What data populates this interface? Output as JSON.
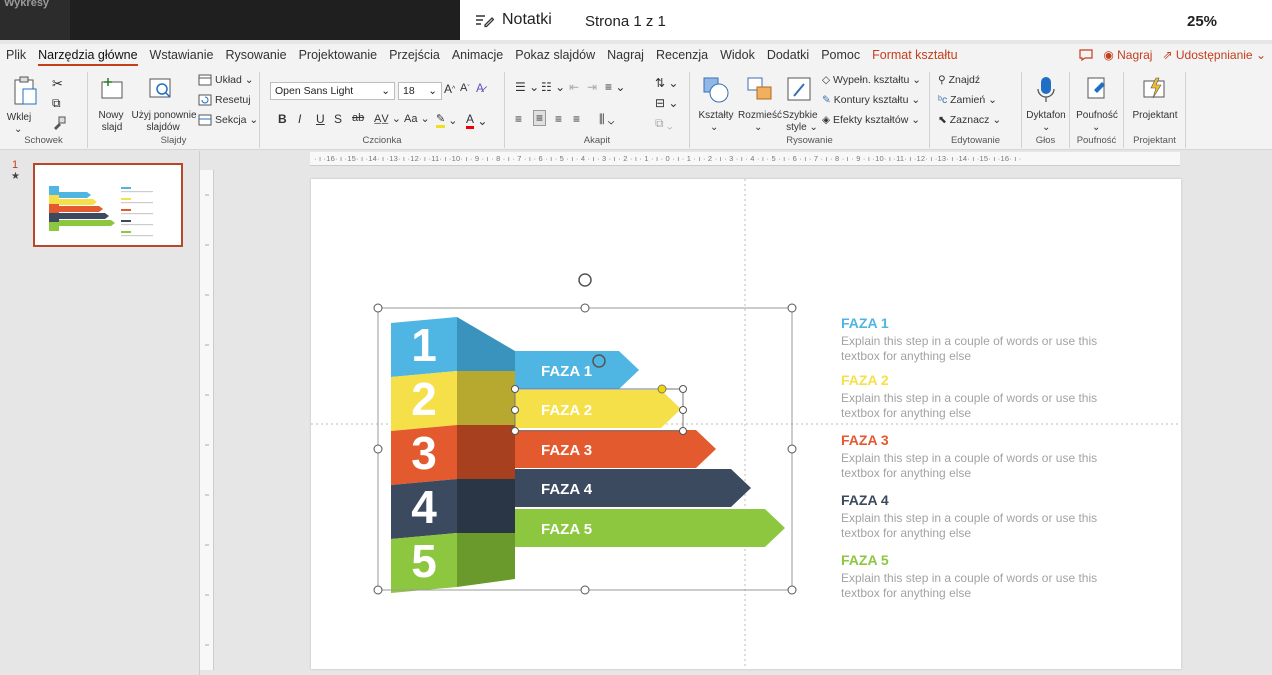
{
  "topbar": {
    "left_tab_label": "Wykresy",
    "notes_label": "Notatki",
    "page_label": "Strona 1 z 1",
    "zoom_label": "25%"
  },
  "menu": {
    "items": [
      "Plik",
      "Narzędzia główne",
      "Wstawianie",
      "Rysowanie",
      "Projektowanie",
      "Przejścia",
      "Animacje",
      "Pokaz slajdów",
      "Nagraj",
      "Recenzja",
      "Widok",
      "Dodatki",
      "Pomoc"
    ],
    "format_tab": "Format kształtu",
    "record_button": "Nagraj",
    "share_button": "Udostępnianie"
  },
  "ribbon": {
    "clipboard": {
      "paste": "Wklej",
      "group": "Schowek"
    },
    "slides": {
      "new_slide_1": "Nowy",
      "new_slide_2": "slajd",
      "reuse_1": "Użyj ponownie",
      "reuse_2": "slajdów",
      "layout": "Układ",
      "reset": "Resetuj",
      "section": "Sekcja",
      "group": "Slajdy"
    },
    "font": {
      "font_name": "Open Sans Light",
      "font_size": "18",
      "group": "Czcionka"
    },
    "paragraph": {
      "group": "Akapit"
    },
    "drawing": {
      "shapes": "Kształty",
      "arrange": "Rozmieść",
      "quick_styles_1": "Szybkie",
      "quick_styles_2": "style",
      "fill": "Wypełn. kształtu",
      "outline": "Kontury kształtu",
      "effects": "Efekty kształtów",
      "group": "Rysowanie"
    },
    "editing": {
      "find": "Znajdź",
      "replace": "Zamień",
      "select": "Zaznacz",
      "group": "Edytowanie"
    },
    "voice": {
      "dictate": "Dyktafon",
      "group": "Głos"
    },
    "sensitivity": {
      "label": "Poufność",
      "group": "Poufność"
    },
    "designer": {
      "label": "Projektant",
      "group": "Projektant"
    }
  },
  "ruler": {
    "horizontal": "· ı ·16· ı ·15· ı ·14· ı ·13· ı ·12· ı ·11· ı ·10· ı · 9 · ı · 8 · ı · 7 · ı · 6 · ı · 5 · ı · 4 · ı · 3 · ı · 2 · ı · 1 · ı · 0 · ı · 1 · ı · 2 · ı · 3 · ı · 4 · ı · 5 · ı · 6 · ı · 7 · ı · 8 · ı · 9 · ı ·10· ı ·11· ı ·12· ı ·13· ı ·14· ı ·15· ı ·16· ı ·"
  },
  "thumbnail": {
    "slide_number": "1",
    "marker": "★"
  },
  "slide": {
    "steps": [
      {
        "num": "1",
        "label": "FAZA 1",
        "title": "FAZA 1",
        "desc": "Explain this step in a couple of words or use this textbox for anything else",
        "color": "#4fb5e2",
        "dark": "#3a93bd"
      },
      {
        "num": "2",
        "label": "FAZA 2",
        "title": "FAZA 2",
        "desc": "Explain this step in a couple of words or use this textbox for anything else",
        "color": "#f6e04a",
        "dark": "#b7a830"
      },
      {
        "num": "3",
        "label": "FAZA 3",
        "title": "FAZA 3",
        "desc": "Explain this step in a couple of words or use this textbox for anything else",
        "color": "#e35a2f",
        "dark": "#a7401e"
      },
      {
        "num": "4",
        "label": "FAZA 4",
        "title": "FAZA 4",
        "desc": "Explain this step in a couple of words or use this textbox for anything else",
        "color": "#3c4a5f",
        "dark": "#2a3546"
      },
      {
        "num": "5",
        "label": "FAZA 5",
        "title": "FAZA 5",
        "desc": "Explain this step in a couple of words or use this textbox for anything else",
        "color": "#8dc63f",
        "dark": "#6a9a2c"
      }
    ]
  }
}
